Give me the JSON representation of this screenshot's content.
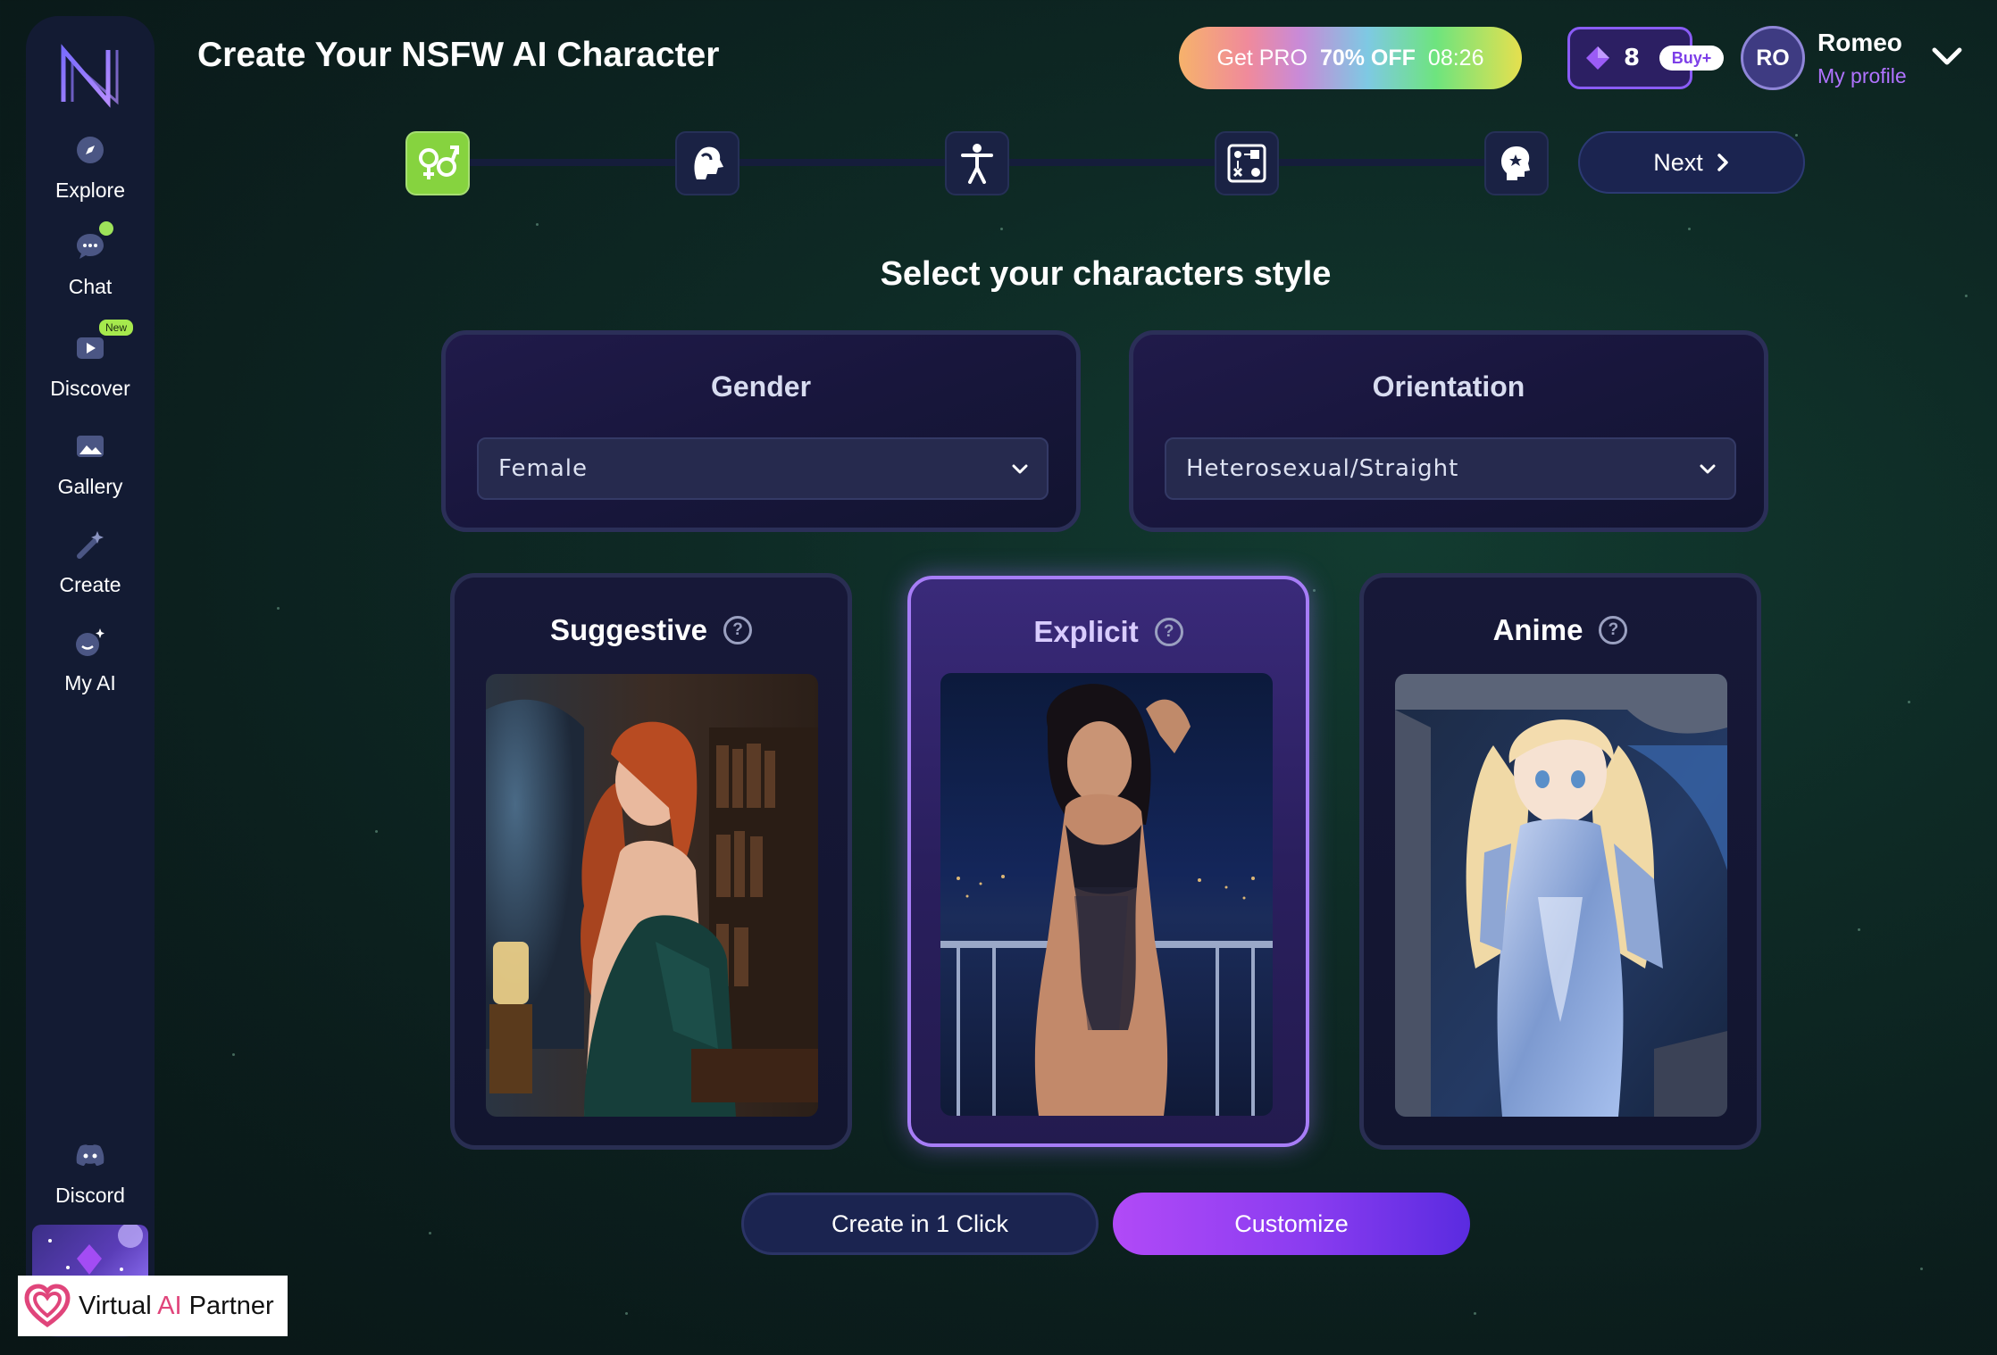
{
  "header": {
    "title": "Create Your NSFW AI Character",
    "promo": {
      "lead": "Get PRO",
      "discount": "70% OFF",
      "timer": "08:26"
    },
    "gems": {
      "count": "8",
      "buy_label": "Buy+"
    },
    "user": {
      "initials": "RO",
      "name": "Romeo",
      "profile_link": "My profile"
    }
  },
  "sidebar": {
    "items": [
      {
        "label": "Explore",
        "icon": "compass-icon"
      },
      {
        "label": "Chat",
        "icon": "chat-bubble-icon"
      },
      {
        "label": "Discover",
        "icon": "play-icon",
        "badge": "New"
      },
      {
        "label": "Gallery",
        "icon": "image-icon"
      },
      {
        "label": "Create",
        "icon": "magic-wand-icon"
      },
      {
        "label": "My AI",
        "icon": "ai-face-icon"
      }
    ],
    "discord_label": "Discord"
  },
  "stepper": {
    "steps": [
      "gender-icon",
      "head-profile-icon",
      "body-icon",
      "traits-icon",
      "personality-icon"
    ],
    "active_step": 1,
    "next_label": "Next"
  },
  "main": {
    "section_title": "Select your characters style",
    "gender": {
      "label": "Gender",
      "value": "Female"
    },
    "orientation": {
      "label": "Orientation",
      "value": "Heterosexual/Straight"
    },
    "styles": [
      {
        "label": "Suggestive",
        "selected": false
      },
      {
        "label": "Explicit",
        "selected": true
      },
      {
        "label": "Anime",
        "selected": false
      }
    ],
    "create_one_click_label": "Create in 1 Click",
    "customize_label": "Customize"
  },
  "watermark": {
    "text_a": "Virtual ",
    "text_b": "AI",
    "text_c": " Partner"
  },
  "colors": {
    "accent_green": "#86d33f",
    "accent_purple": "#8a3cf0",
    "sidebar_bg": "#131b33"
  }
}
